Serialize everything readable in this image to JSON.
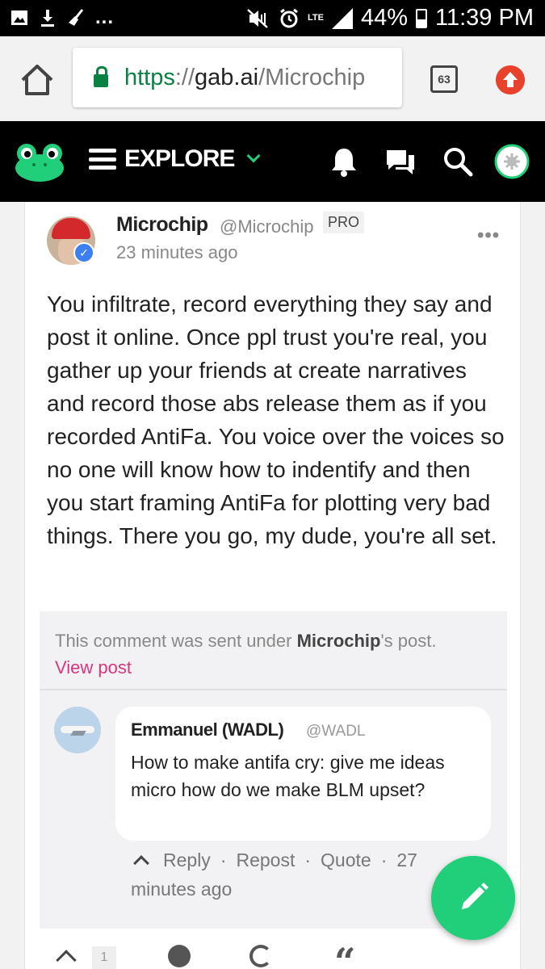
{
  "status_bar": {
    "network": "LTE",
    "battery": "44%",
    "time": "11:39 PM",
    "notification_more": "..."
  },
  "browser": {
    "url_scheme": "https",
    "url_sep": "://",
    "url_host": "gab.ai",
    "url_path": "/Microchip",
    "tab_count": "63"
  },
  "nav": {
    "explore_label": "EXPLORE"
  },
  "post": {
    "author_name": "Microchip",
    "author_handle": "@Microchip",
    "badge": "PRO",
    "time": "23 minutes ago",
    "more": "•••",
    "body": "You infiltrate, record everything they say and post it online. Once ppl trust you're real, you gather up your friends at create narratives and record those abs release them as if you recorded AntiFa. You voice over the voices so no one will know how to indentify and then you start framing AntiFa for plotting very bad things. There you go, my dude, you're all set.",
    "note_prefix": "This comment was sent under ",
    "note_name": "Microchip",
    "note_suffix": "'s post.",
    "note_link": "View post",
    "like_count": "1"
  },
  "comment": {
    "author_name": "Emmanuel (WADL)",
    "author_handle": "@WADL",
    "text": "How to make antifa cry: give me ideas micro how do we make BLM upset?",
    "reply_label": "Reply",
    "repost_label": "Repost",
    "quote_label": "Quote",
    "separator": "·",
    "time": "27 minutes ago"
  },
  "colors": {
    "accent_green": "#21cf7a",
    "link_pink": "#d7357e",
    "secure_green": "#0b8043",
    "nav_bg": "#000000"
  },
  "icons": {
    "status_left": [
      "image-icon",
      "download-icon",
      "broom-icon"
    ],
    "status_right": [
      "mute-vibrate-icon",
      "alarm-icon",
      "signal-icon",
      "battery-icon"
    ],
    "browser": [
      "home-icon",
      "lock-icon",
      "tabs-icon",
      "update-icon"
    ],
    "nav": [
      "frog-logo-icon",
      "menu-icon",
      "chevron-down-icon",
      "bell-icon",
      "messages-icon",
      "search-icon",
      "avatar"
    ],
    "actions": [
      "upvote-icon",
      "comment-icon",
      "repost-icon",
      "quote-icon",
      "pencil-icon"
    ]
  }
}
